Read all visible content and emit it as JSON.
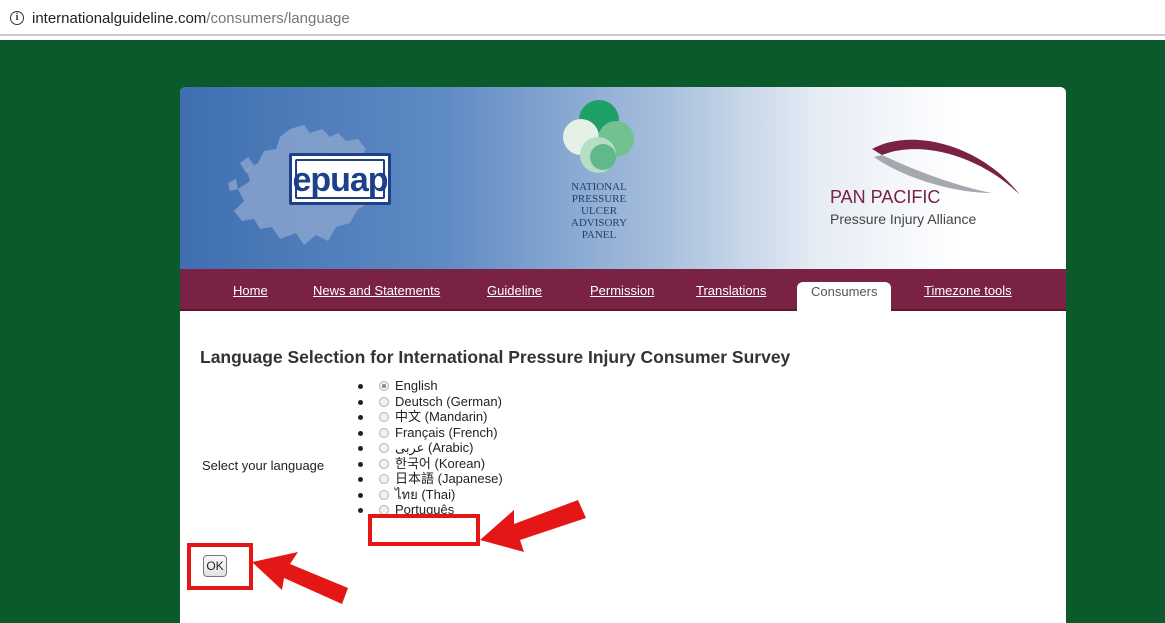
{
  "browser": {
    "url_domain": "internationalguideline.com",
    "url_path": "/consumers/language",
    "info_icon": "info-icon"
  },
  "banner": {
    "epuap_logo": "epuap",
    "npuap_logo_lines": [
      "NATIONAL",
      "PRESSURE",
      "ULCER",
      "ADVISORY",
      "PANEL"
    ],
    "pan_pacific_line1": "PAN PACIFIC",
    "pan_pacific_line2": "Pressure Injury Alliance"
  },
  "nav": {
    "tabs": [
      "Home",
      "News and Statements",
      "Guideline",
      "Permission",
      "Translations",
      "Consumers",
      "Timezone tools"
    ],
    "active": "Consumers"
  },
  "main": {
    "heading": "Language Selection for International Pressure Injury Consumer Survey",
    "select_label": "Select your language",
    "languages": [
      {
        "label": "English",
        "checked": true
      },
      {
        "label": "Deutsch (German)",
        "checked": false
      },
      {
        "label": "中文 (Mandarin)",
        "checked": false
      },
      {
        "label": "Français (French)",
        "checked": false
      },
      {
        "label": "عربى (Arabic)",
        "checked": false
      },
      {
        "label": "한국어 (Korean)",
        "checked": false
      },
      {
        "label": "日本語 (Japanese)",
        "checked": false
      },
      {
        "label": "ไทย (Thai)",
        "checked": false
      },
      {
        "label": "Português",
        "checked": false
      }
    ],
    "ok_label": "OK"
  },
  "colors": {
    "page_bg": "#0a5a2c",
    "nav_bg": "#7a2243",
    "highlight": "#e51616"
  }
}
